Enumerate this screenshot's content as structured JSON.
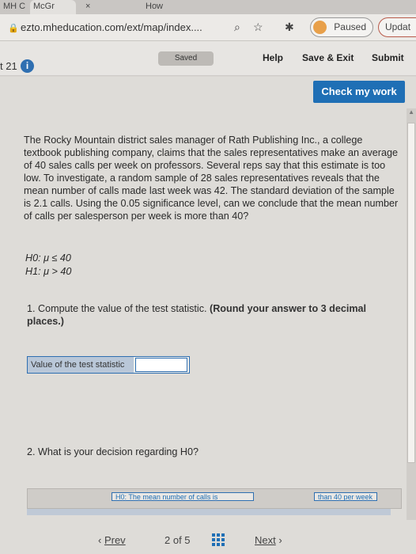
{
  "browser": {
    "tabs": [
      "MH C",
      "McGr",
      "× ",
      "How"
    ],
    "url": "ezto.mheducation.com/ext/map/index....",
    "paused_label": "Paused",
    "update_label": "Updat"
  },
  "header": {
    "question_num": "t 21",
    "info_icon": "i",
    "saved_label": "Saved",
    "help_label": "Help",
    "save_exit_label": "Save & Exit",
    "submit_label": "Submit"
  },
  "content": {
    "check_label": "Check my work",
    "question": "The Rocky Mountain district sales manager of Rath Publishing Inc., a college textbook publishing company, claims that the sales representatives make an average of 40 sales calls per week on professors. Several reps say that this estimate is too low. To investigate, a random sample of 28 sales representatives reveals that the mean number of calls made last week was 42. The standard deviation of the sample is 2.1 calls. Using the 0.05 significance level, can we conclude that the mean number of calls per salesperson per week is more than 40?",
    "h0": "H0: μ ≤ 40",
    "h1": "H1: μ > 40",
    "part1_text": "1. Compute the value of the test statistic.",
    "part1_bold": "(Round your answer to 3 decimal places.)",
    "value_label": "Value of the test statistic",
    "value_input": "",
    "part2_text": "2. What is your decision regarding H0?",
    "option1": "H0: The mean number of calls is",
    "option2": "than 40 per week"
  },
  "nav": {
    "prev_label": "Prev",
    "page_label": "2 of 5",
    "next_label": "Next"
  }
}
